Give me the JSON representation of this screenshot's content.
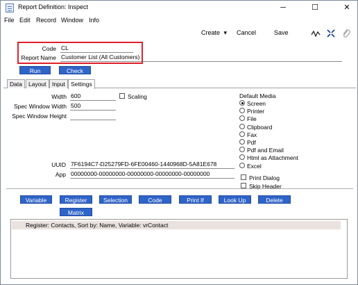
{
  "window": {
    "title": "Report Definition: Inspect",
    "controls": {
      "minimize": "─",
      "maximize": "☐",
      "close": "✕"
    }
  },
  "menubar": {
    "items": [
      "File",
      "Edit",
      "Record",
      "Window",
      "Info"
    ]
  },
  "toolbar": {
    "create_label": "Create",
    "create_arrow": "▾",
    "cancel_label": "Cancel",
    "save_label": "Save",
    "icons": [
      "pulse-icon",
      "collapse-icon",
      "paperclip-icon"
    ]
  },
  "header": {
    "code_label": "Code",
    "code_value": "CL",
    "report_name_label": "Report Name",
    "report_name_value": "Customer List (All Customers)",
    "run_label": "Run",
    "check_label": "Check"
  },
  "tabs": [
    "Data",
    "Layout",
    "Input",
    "Settings"
  ],
  "active_tab": "Settings",
  "settings": {
    "width_label": "Width",
    "width_value": "600",
    "scaling_label": "Scaling",
    "spec_window_width_label": "Spec Window Width",
    "spec_window_width_value": "500",
    "spec_window_height_label": "Spec Window Height",
    "spec_window_height_value": "",
    "uuid_label": "UUID",
    "uuid_value": "7F6194C7-D25279FD-6FE00460-1440968D-5A81E678",
    "app_label": "App",
    "app_value": "00000000-00000000-00000000-00000000-00000000",
    "default_media_label": "Default Media",
    "media_options": [
      "Screen",
      "Printer",
      "File",
      "Clipboard",
      "Fax",
      "Pdf",
      "Pdf and Email",
      "Html as Attachment",
      "Excel"
    ],
    "media_selected": "Screen",
    "print_dialog_label": "Print Dialog",
    "skip_header_label": "Skip Header"
  },
  "actions": {
    "row1": [
      "Variable",
      "Register",
      "Selection",
      "Code",
      "Print If",
      "Look Up",
      "Delete"
    ],
    "row2": [
      "Matrix"
    ]
  },
  "list": {
    "rows": [
      "Register: Contacts, Sort by: Name, Variable: vrContact"
    ]
  },
  "colors": {
    "accent_button": "#2f64c8",
    "highlight_box": "#e0202a",
    "list_row_bg": "#e9e2df"
  }
}
